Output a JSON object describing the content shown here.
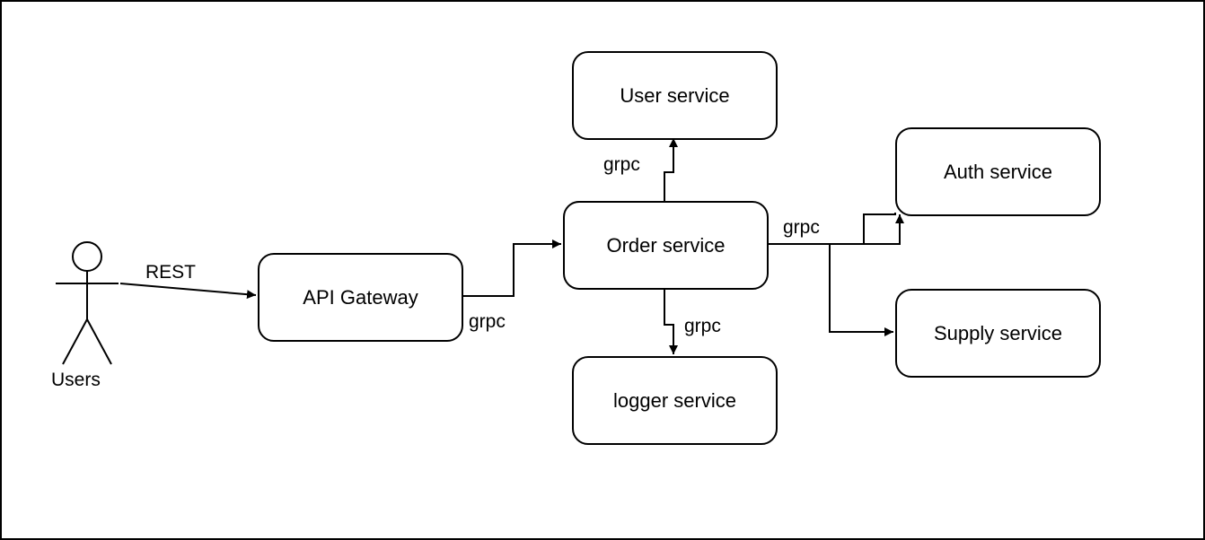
{
  "actor": {
    "label": "Users"
  },
  "nodes": {
    "gateway": "API Gateway",
    "order": "Order service",
    "user": "User service",
    "logger": "logger service",
    "auth": "Auth service",
    "supply": "Supply service"
  },
  "edges": {
    "users_gateway": "REST",
    "gateway_order": "grpc",
    "order_user": "grpc",
    "order_logger": "grpc",
    "order_auth": "grpc"
  }
}
